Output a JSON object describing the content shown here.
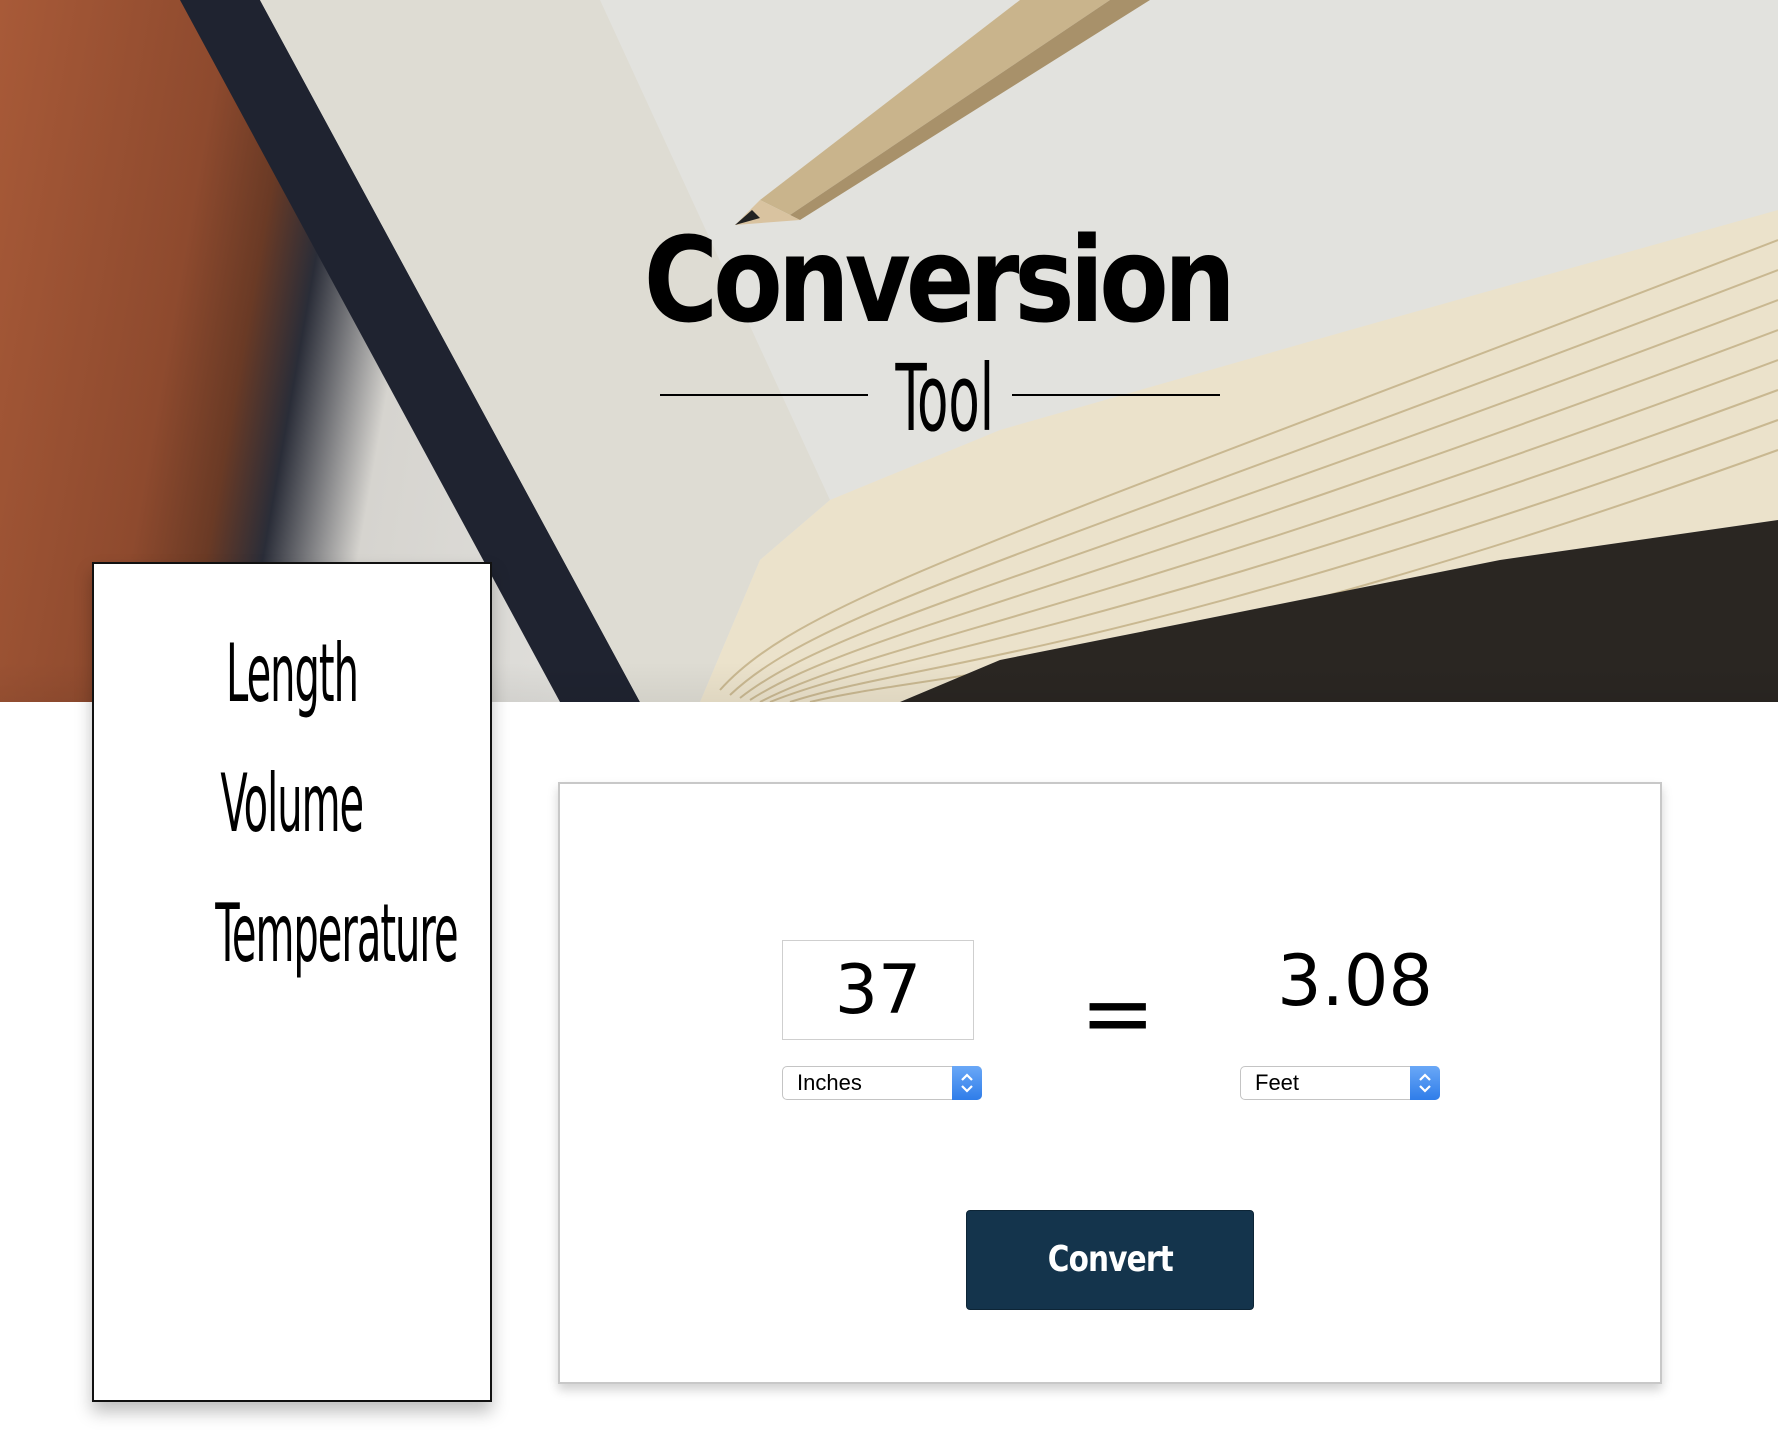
{
  "header": {
    "title": "Conversion",
    "subtitle": "Tool"
  },
  "sidebar": {
    "items": [
      {
        "label": "Length"
      },
      {
        "label": "Volume"
      },
      {
        "label": "Temperature"
      }
    ]
  },
  "converter": {
    "input_value": "37",
    "equals_symbol": "=",
    "result_value": "3.08",
    "from_unit": "Inches",
    "to_unit": "Feet",
    "convert_label": "Convert"
  },
  "colors": {
    "button_bg": "#14344c",
    "stepper_blue": "#2f7de9"
  }
}
